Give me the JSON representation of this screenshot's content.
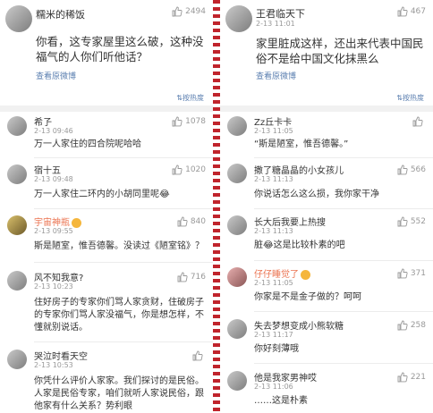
{
  "left": {
    "post": {
      "username": "糯米的稀饭",
      "likes": "2494",
      "text": "你看，这专家屋里这么破，这种没福气的人你们听他话？",
      "view_original": "查看原微博",
      "sort_label": "按热度"
    },
    "comments": [
      {
        "username": "希孒",
        "time": "2-13 09:46",
        "likes": "1078",
        "text": "万一人家住的四合院呢哈哈"
      },
      {
        "username": "宿十五",
        "time": "2-13 09:48",
        "likes": "1020",
        "text": "万一人家住二环内的小胡同里呢😂"
      },
      {
        "username": "宇宙神瓶",
        "time": "2-13 09:55",
        "likes": "840",
        "text": "斯是陋室，惟吾德馨。没读过《陋室铭》？"
      },
      {
        "username": "风不知我意?",
        "time": "2-13 10:23",
        "likes": "716",
        "text": "住好房子的专家你们骂人家贪财，住破房子的专家你们骂人家没福气，你是想怎样，不懂就别说话。"
      },
      {
        "username": "哭泣时看天空",
        "time": "2-13 10:53",
        "likes": "",
        "text": "你凭什么评价人家家。我们探讨的是民俗。人家是民俗专家，咱们就听人家说民俗，跟他家有什么关系？势利眼"
      }
    ]
  },
  "right": {
    "post": {
      "username": "王君临天下",
      "time": "2-13 11:01",
      "likes": "467",
      "text": "家里脏成这样，还出来代表中国民俗不是给中国文化抹黑么",
      "view_original": "查看原微博",
      "sort_label": "按热度"
    },
    "comments": [
      {
        "username": "Zz丘卡卡",
        "time": "2-13 11:05",
        "likes": "",
        "text": "“斯是陋室，惟吾德馨。”"
      },
      {
        "username": "撒了糖晶晶的小女孩儿",
        "time": "2-13 11:13",
        "likes": "566",
        "text": "你说话怎么这么损，我你家干净"
      },
      {
        "username": "长大后我要上热搜",
        "time": "2-13 11:13",
        "likes": "552",
        "text": "脏😂这是比较朴素的吧"
      },
      {
        "username": "仔仔睡觉了",
        "time": "2-13 11:05",
        "likes": "371",
        "text": "你家是不是金子做的？呵呵"
      },
      {
        "username": "失去梦想变成小熊软糖",
        "time": "2-13 11:17",
        "likes": "258",
        "text": "你好刻薄哦"
      },
      {
        "username": "他是我家男神哎",
        "time": "2-13 11:06",
        "likes": "221",
        "text": "……这是朴素"
      }
    ]
  },
  "colors": {
    "link": "#5b7fb0",
    "accent": "#eb7350",
    "divider": "#c0242c"
  }
}
